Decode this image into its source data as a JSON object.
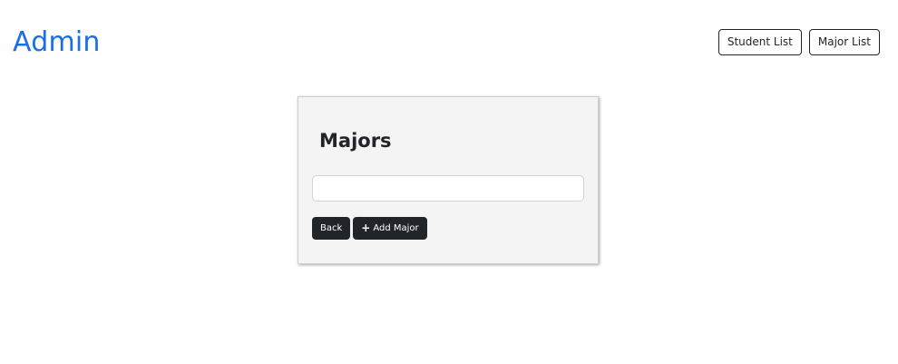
{
  "header": {
    "brand": "Admin",
    "nav": [
      {
        "label": "Student List"
      },
      {
        "label": "Major List"
      }
    ]
  },
  "card": {
    "title": "Majors",
    "input": {
      "value": "",
      "placeholder": ""
    },
    "buttons": {
      "back_label": "Back",
      "add_label": "Add Major",
      "add_icon": "plus-icon"
    }
  },
  "colors": {
    "brand": "#1a6ee8",
    "dark_button": "#212529",
    "card_background": "#f4f4f4"
  }
}
